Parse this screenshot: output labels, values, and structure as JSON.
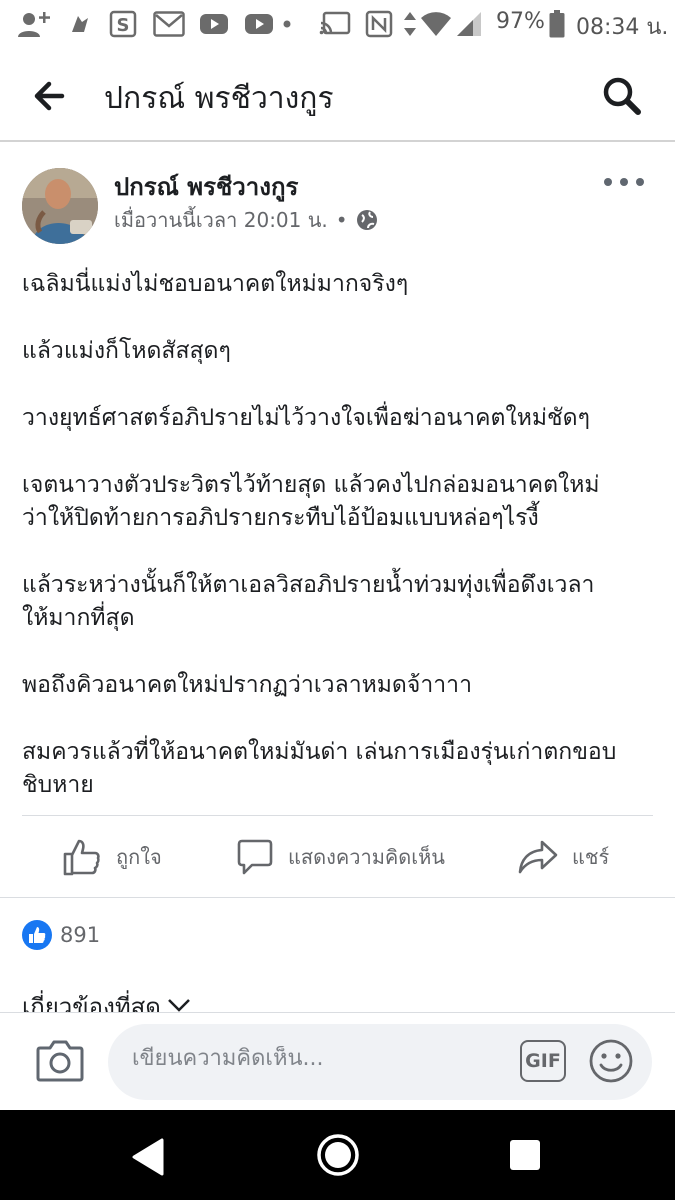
{
  "status_bar": {
    "battery": "97%",
    "time": "08:34 น."
  },
  "header": {
    "title": "ปกรณ์ พรชีวางกูร"
  },
  "post": {
    "author": "ปกรณ์ พรชีวางกูร",
    "timestamp": "เมื่อวานนี้เวลา 20:01 น.",
    "separator": "•",
    "audience_icon": "globe-icon",
    "paragraphs": [
      "เฉลิมนี่แม่งไม่ชอบอนาคตใหม่มากจริงๆ",
      "แล้วแม่งก็โหดสัสสุดๆ",
      "วางยุทธ์ศาสตร์อภิปรายไม่ไว้วางใจเพื่อฆ่าอนาคตใหม่ชัดๆ",
      "เจตนาวางตัวประวิตรไว้ท้ายสุด แล้วคงไปกล่อมอนาคตใหม่\nว่าให้ปิดท้ายการอภิปรายกระทืบไอ้ป้อมแบบหล่อๆไรงี้",
      "แล้วระหว่างนั้นก็ให้ตาเอลวิสอภิปรายน้ำท่วมทุ่งเพื่อดึงเวลา\nให้มากที่สุด",
      "พอถึงคิวอนาคตใหม่ปรากฏว่าเวลาหมดจ้าาาา",
      "สมควรแล้วที่ให้อนาคตใหม่มันด่า เล่นการเมืองรุ่นเก่าตกขอบ\nชิบหาย"
    ]
  },
  "actions": {
    "like": "ถูกใจ",
    "comment": "แสดงความคิดเห็น",
    "share": "แชร์"
  },
  "reactions": {
    "count": "891"
  },
  "comments_filter": {
    "label": "เกี่ยวข้องที่สุด"
  },
  "composer": {
    "placeholder": "เขียนความคิดเห็น...",
    "gif_label": "GIF"
  },
  "colors": {
    "accent": "#1877f2",
    "icon_gray": "#606770",
    "text": "#1c1e21"
  }
}
